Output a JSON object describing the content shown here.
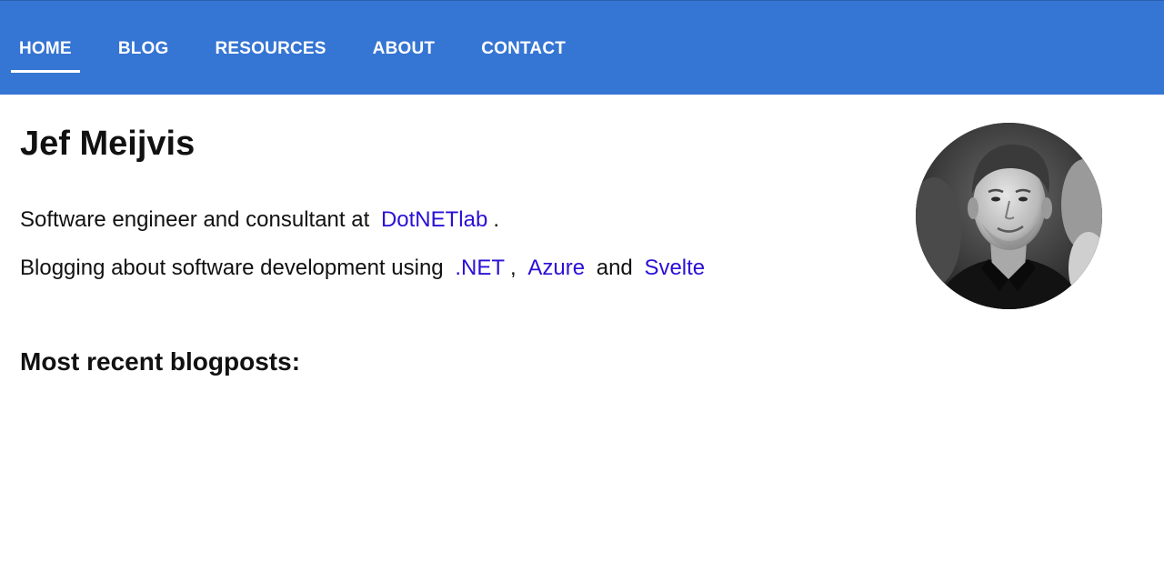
{
  "nav": {
    "items": [
      {
        "label": "HOME",
        "active": true
      },
      {
        "label": "BLOG",
        "active": false
      },
      {
        "label": "RESOURCES",
        "active": false
      },
      {
        "label": "ABOUT",
        "active": false
      },
      {
        "label": "CONTACT",
        "active": false
      }
    ],
    "color": "#3575d3"
  },
  "profile": {
    "name": "Jef Meijvis",
    "line1": {
      "prefix": "Software engineer and consultant at",
      "link": "DotNETlab",
      "suffix": "."
    },
    "line2": {
      "prefix": "Blogging about software development using",
      "link1": ".NET",
      "sep1": ",",
      "link2": "Azure",
      "sep2": "and",
      "link3": "Svelte"
    },
    "link_color": "#2a10d6",
    "avatar": "profile-photo"
  },
  "recent": {
    "heading": "Most recent blogposts:"
  }
}
